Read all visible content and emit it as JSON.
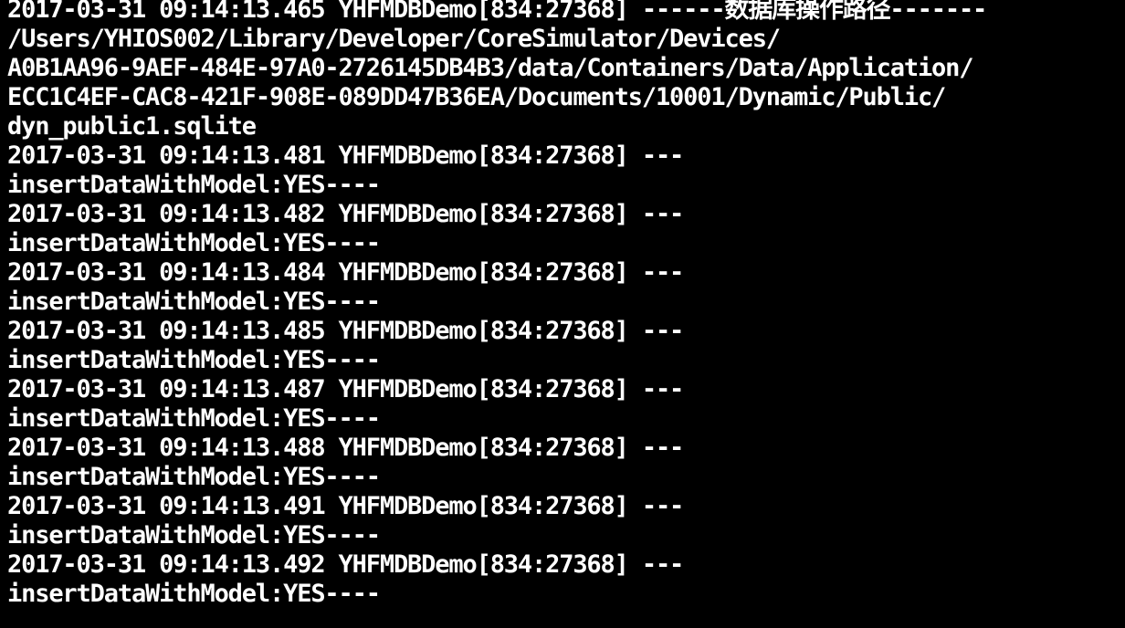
{
  "console": {
    "lines": [
      "2017-03-31 09:14:13.465 YHFMDBDemo[834:27368] ------数据库操作路径-------",
      "/Users/YHIOS002/Library/Developer/CoreSimulator/Devices/",
      "A0B1AA96-9AEF-484E-97A0-2726145DB4B3/data/Containers/Data/Application/",
      "ECC1C4EF-CAC8-421F-908E-089DD47B36EA/Documents/10001/Dynamic/Public/",
      "dyn_public1.sqlite",
      "2017-03-31 09:14:13.481 YHFMDBDemo[834:27368] ---",
      "insertDataWithModel:YES----",
      "2017-03-31 09:14:13.482 YHFMDBDemo[834:27368] ---",
      "insertDataWithModel:YES----",
      "2017-03-31 09:14:13.484 YHFMDBDemo[834:27368] ---",
      "insertDataWithModel:YES----",
      "2017-03-31 09:14:13.485 YHFMDBDemo[834:27368] ---",
      "insertDataWithModel:YES----",
      "2017-03-31 09:14:13.487 YHFMDBDemo[834:27368] ---",
      "insertDataWithModel:YES----",
      "2017-03-31 09:14:13.488 YHFMDBDemo[834:27368] ---",
      "insertDataWithModel:YES----",
      "2017-03-31 09:14:13.491 YHFMDBDemo[834:27368] ---",
      "insertDataWithModel:YES----",
      "2017-03-31 09:14:13.492 YHFMDBDemo[834:27368] ---",
      "insertDataWithModel:YES----"
    ]
  },
  "colors": {
    "background": "#000000",
    "text": "#ffffff"
  }
}
